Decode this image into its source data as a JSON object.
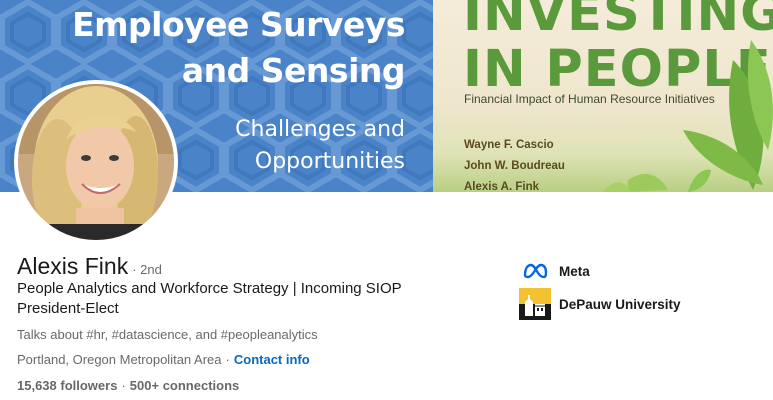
{
  "banner": {
    "left_title_line1": "Employee Surveys",
    "left_title_line2": "and Sensing",
    "left_sub_line1": "Challenges and",
    "left_sub_line2": "Opportunities",
    "book_title_line1": "INVESTING",
    "book_title_line2": "IN PEOPLE",
    "book_subtitle": "Financial Impact of Human Resource Initiatives",
    "authors": [
      "Wayne F. Cascio",
      "John W. Boudreau",
      "Alexis A. Fink"
    ],
    "left_color": "#4a83c8",
    "book_title_color": "#5a9a3c"
  },
  "profile": {
    "name": "Alexis Fink",
    "degree": "· 2nd",
    "headline": "People Analytics and Workforce Strategy | Incoming SIOP President-Elect",
    "talks_about": "Talks about #hr, #datascience, and #peopleanalytics",
    "location": "Portland, Oregon Metropolitan Area",
    "location_sep": "·",
    "contact_info": "Contact info",
    "followers": "15,638 followers",
    "stats_sep": "·",
    "connections": "500+ connections"
  },
  "organizations": [
    {
      "name": "Meta",
      "icon": "meta-logo-icon"
    },
    {
      "name": "DePauw University",
      "icon": "depauw-logo-icon"
    }
  ],
  "colors": {
    "link": "#0a66c2",
    "meta_blue": "#0668e1"
  }
}
